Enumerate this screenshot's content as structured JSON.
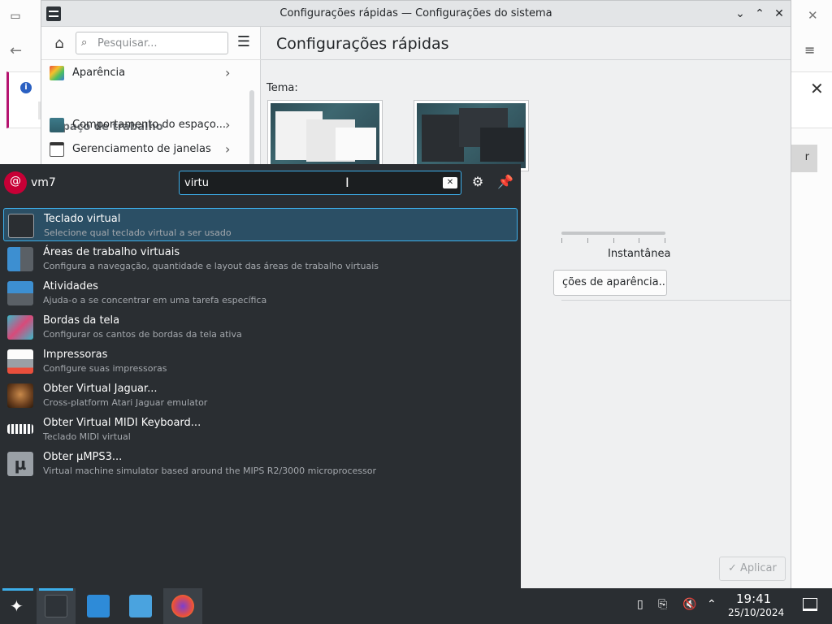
{
  "window": {
    "title": "Configurações rápidas — Configurações do sistema",
    "btn_minimize": "⌄",
    "btn_maximize": "⌃",
    "btn_close": "✕"
  },
  "sidebar": {
    "search_placeholder": "Pesquisar...",
    "items": [
      {
        "label": "Aparência"
      },
      {
        "label": "Comportamento do espaço..."
      },
      {
        "label": "Gerenciamento de janelas"
      }
    ],
    "section_workspace": "Espaço de trabalho"
  },
  "content": {
    "heading": "Configurações rápidas",
    "theme_label": "Tema:",
    "animation_end_label": "Instantânea",
    "more_appearance_btn": "ções de aparência...",
    "apply_btn": "✓ Aplicar"
  },
  "background": {
    "notice_close": "✕",
    "grey_btn": "r"
  },
  "krunner": {
    "user": "vm7",
    "query": "virtu",
    "results": [
      {
        "title": "Teclado virtual",
        "subtitle": "Selecione qual teclado virtual a ser usado",
        "icon": "keyboard-icon"
      },
      {
        "title": "Áreas de trabalho virtuais",
        "subtitle": "Configura a navegação, quantidade e layout das áreas de trabalho virtuais",
        "icon": "virtual-desktops-icon"
      },
      {
        "title": "Atividades",
        "subtitle": "Ajuda-o a se concentrar em uma tarefa específica",
        "icon": "activities-icon"
      },
      {
        "title": "Bordas da tela",
        "subtitle": "Configurar os cantos de bordas da tela ativa",
        "icon": "screen-edges-icon"
      },
      {
        "title": "Impressoras",
        "subtitle": "Configure suas impressoras",
        "icon": "printer-icon"
      },
      {
        "title": "Obter Virtual Jaguar...",
        "subtitle": "Cross-platform Atari Jaguar emulator",
        "icon": "jaguar-icon"
      },
      {
        "title": "Obter Virtual MIDI Keyboard...",
        "subtitle": "Teclado MIDI virtual",
        "icon": "midi-keyboard-icon"
      },
      {
        "title": "Obter µMPS3...",
        "subtitle": "Virtual machine simulator based around the MIPS R2/3000 microprocessor",
        "icon": "umps-icon"
      }
    ]
  },
  "taskbar": {
    "time": "19:41",
    "date": "25/10/2024"
  },
  "colors": {
    "accent": "#3daee9",
    "panel_dark": "#2a2e32",
    "selection": "#2b4f65"
  }
}
